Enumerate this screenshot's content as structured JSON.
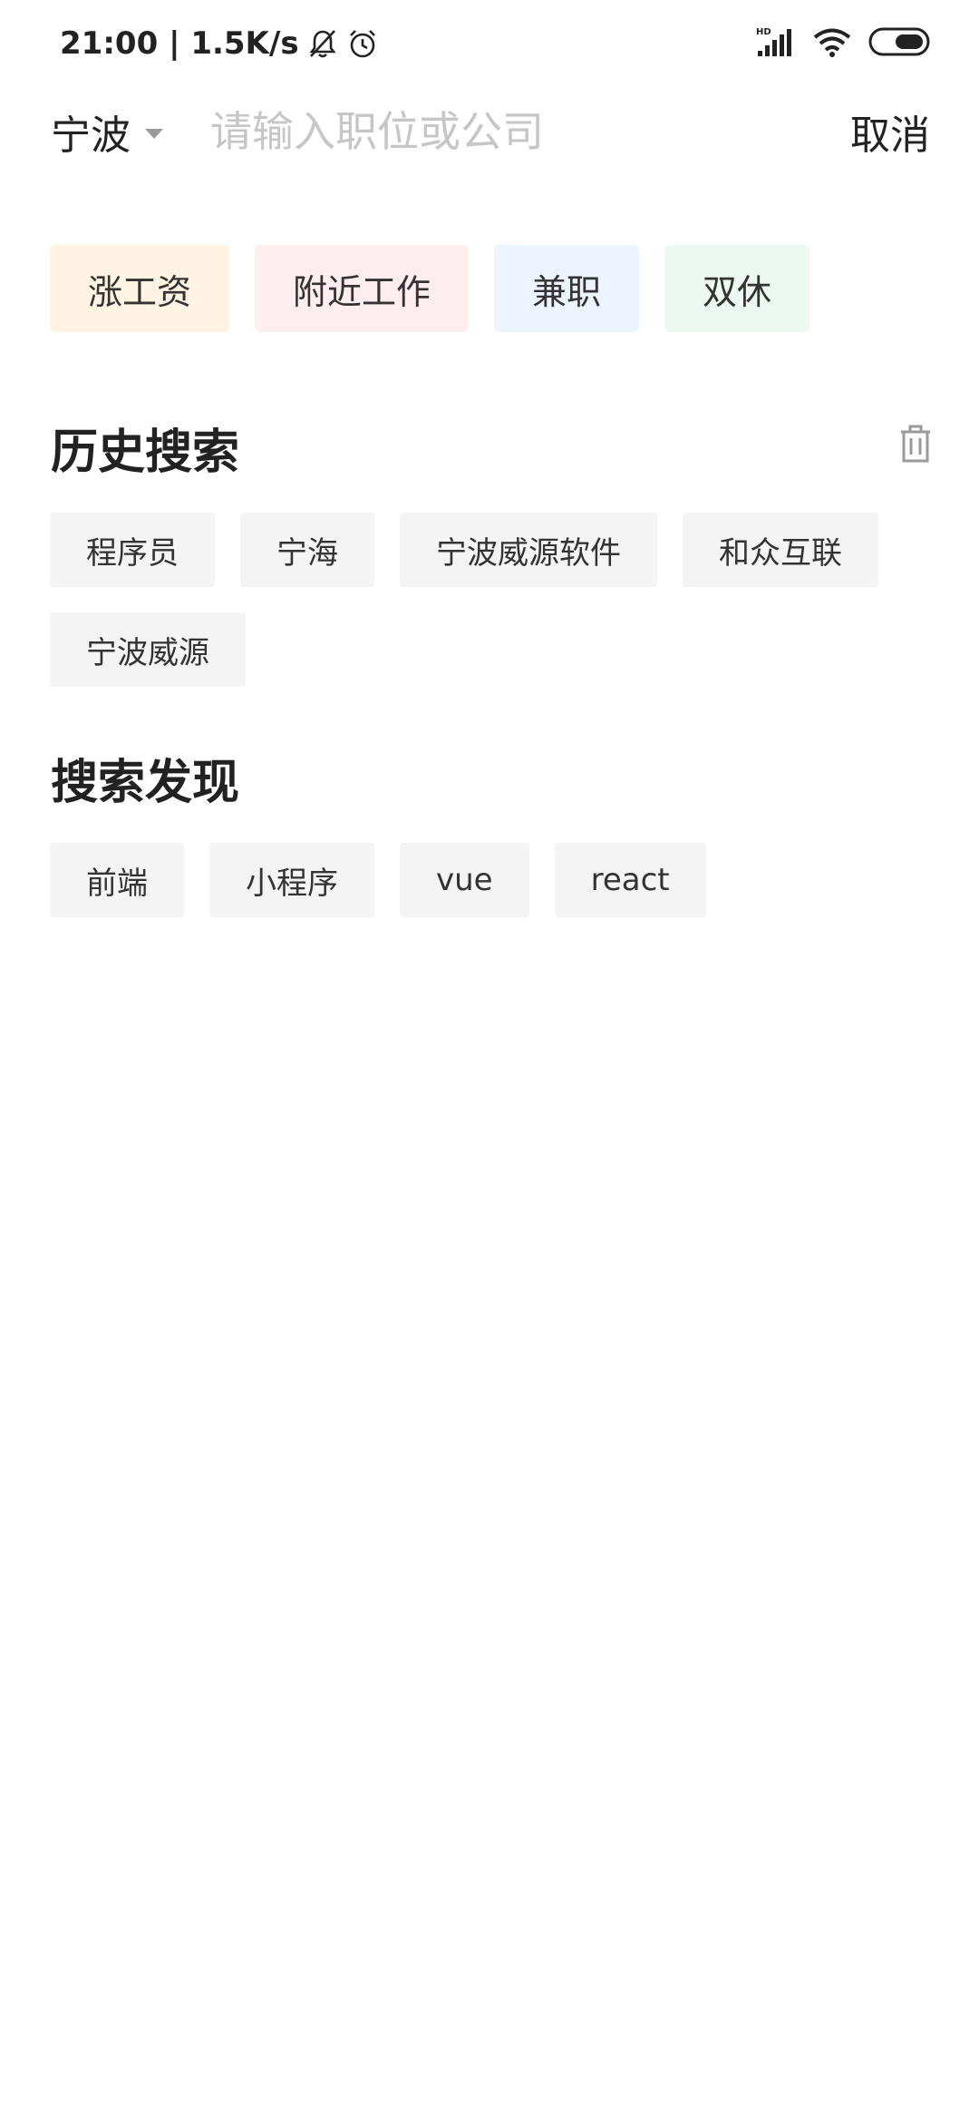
{
  "status_bar": {
    "time_speed": "21:00 | 1.5K/s",
    "icons": [
      "mute-bell-icon",
      "alarm-icon",
      "hd-signal-icon",
      "wifi-icon",
      "battery-icon"
    ]
  },
  "header": {
    "city": "宁波",
    "search_placeholder": "请输入职位或公司",
    "cancel_label": "取消"
  },
  "quick_tags": [
    {
      "label": "涨工资",
      "bg": "#fff3e3"
    },
    {
      "label": "附近工作",
      "bg": "#ffedef"
    },
    {
      "label": "兼职",
      "bg": "#edf3ff"
    },
    {
      "label": "双休",
      "bg": "#edf8f2"
    }
  ],
  "history": {
    "title": "历史搜索",
    "items": [
      "程序员",
      "宁海",
      "宁波威源软件",
      "和众互联",
      "宁波威源"
    ]
  },
  "discover": {
    "title": "搜索发现",
    "items": [
      "前端",
      "小程序",
      "vue",
      "react"
    ]
  }
}
